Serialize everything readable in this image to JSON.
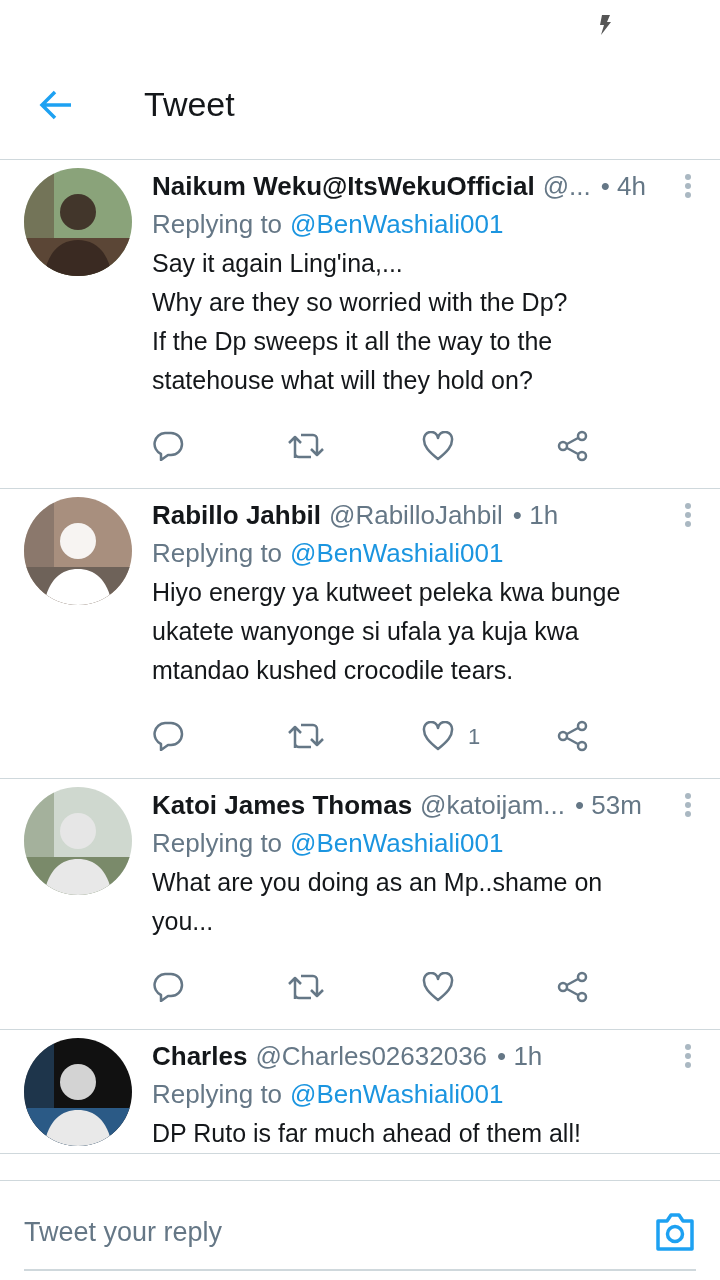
{
  "header": {
    "title": "Tweet"
  },
  "tweets": [
    {
      "name": "Naikum Weku@ItsWekuOfficial",
      "handle": "@...",
      "time": "• 4h",
      "replying_label": "Replying to",
      "replying_to": "@BenWashiali001",
      "lines": [
        "Say it again Ling'ina,...",
        "Why are they so worried with the Dp?",
        "If the Dp sweeps it all the way to the",
        "statehouse what will they hold on?"
      ],
      "avatar": {
        "kind": "picture"
      }
    },
    {
      "name": "Rabillo Jahbil",
      "handle": "@RabilloJahbil",
      "time": "• 1h",
      "replying_label": "Replying to",
      "replying_to": "@BenWashiali001",
      "lines": [
        "Hiyo energy ya kutweet peleka kwa bunge",
        "ukatete wanyonge si ufala ya kuja kwa",
        "mtandao kushed crocodile tears."
      ],
      "like_count": "1",
      "avatar": {
        "kind": "picture"
      }
    },
    {
      "name": "Katoi James Thomas",
      "handle": "@katoijam...",
      "time": "• 53m",
      "replying_label": "Replying to",
      "replying_to": "@BenWashiali001",
      "lines": [
        "What are you doing as an Mp..shame on",
        "you..."
      ],
      "avatar": {
        "kind": "picture"
      }
    },
    {
      "name": "Charles",
      "handle": "@Charles02632036",
      "time": "• 1h",
      "replying_label": "Replying to",
      "replying_to": "@BenWashiali001",
      "lines": [
        "DP Ruto is far much ahead of them all!"
      ],
      "avatar": {
        "kind": "picture"
      }
    }
  ],
  "reply_bar": {
    "placeholder": "Tweet your reply"
  }
}
